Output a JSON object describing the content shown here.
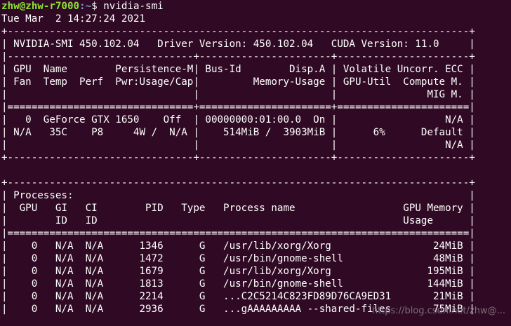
{
  "prompt": {
    "user_host": "zhw@zhw-r7000",
    "path": ":~",
    "symbol": "$ ",
    "command": "nvidia-smi"
  },
  "output_lines": [
    "Tue Mar  2 14:27:24 2021",
    "+-----------------------------------------------------------------------------+",
    "| NVIDIA-SMI 450.102.04   Driver Version: 450.102.04   CUDA Version: 11.0     |",
    "|-------------------------------+----------------------+----------------------+",
    "| GPU  Name        Persistence-M| Bus-Id        Disp.A | Volatile Uncorr. ECC |",
    "| Fan  Temp  Perf  Pwr:Usage/Cap|         Memory-Usage | GPU-Util  Compute M. |",
    "|                               |                      |               MIG M. |",
    "|===============================+======================+======================|",
    "|   0  GeForce GTX 1650    Off  | 00000000:01:00.0  On |                  N/A |",
    "| N/A   35C    P8     4W /  N/A |    514MiB /  3903MiB |      6%      Default |",
    "|                               |                      |                  N/A |",
    "+-------------------------------+----------------------+----------------------+",
    "",
    "+-----------------------------------------------------------------------------+",
    "| Processes:                                                                  |",
    "|  GPU   GI   CI        PID   Type   Process name                  GPU Memory |",
    "|        ID   ID                                                   Usage      |",
    "|=============================================================================|",
    "|    0   N/A  N/A      1346      G   /usr/lib/xorg/Xorg                 24MiB |",
    "|    0   N/A  N/A      1472      G   /usr/bin/gnome-shell               48MiB |",
    "|    0   N/A  N/A      1679      G   /usr/lib/xorg/Xorg                195MiB |",
    "|    0   N/A  N/A      1813      G   /usr/bin/gnome-shell              144MiB |",
    "|    0   N/A  N/A      2214      G   ...C2C5214C823FD89D76CA9ED31       21MiB |",
    "|    0   N/A  N/A      2936      G   ...gAAAAAAAAA --shared-files       75MiB |"
  ],
  "watermark": "https://blog.csdn.net/zhw@..."
}
